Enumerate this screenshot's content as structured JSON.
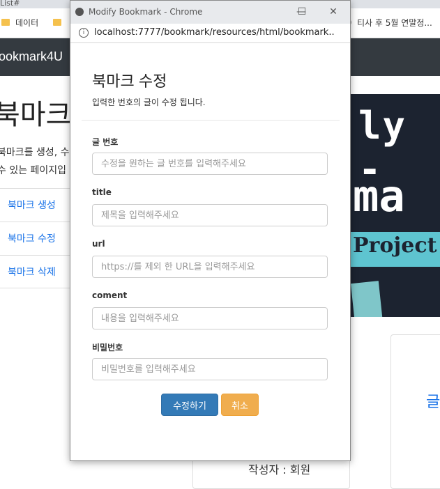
{
  "background": {
    "tab_fragment": "List#",
    "bookmarks_bar": [
      {
        "label": "데이터",
        "icon": "folder-icon"
      },
      {
        "label": "티사 후 5월 연말정...",
        "icon": "globe-icon"
      }
    ],
    "brand": "ookmark4U",
    "heading": "북마크",
    "description_line1": "북마크를 생성, 수",
    "description_line2": "수 있는 페이지입",
    "menu": [
      "북마크 생성",
      "북마크 수정",
      "북마크 삭제"
    ],
    "banner": {
      "line1": "ly -",
      "line2": "ma",
      "line3": "Project"
    },
    "card_title": "글",
    "author": "작성자 : 회원"
  },
  "popup": {
    "window_title": "Modify Bookmark - Chrome",
    "url": "localhost:7777/bookmark/resources/html/bookmark...",
    "form": {
      "title": "북마크 수정",
      "subtitle": "입력한 번호의 글이 수정 됩니다.",
      "fields": [
        {
          "label": "글 번호",
          "placeholder": "수정을 원하는 글 번호를 입력해주세요"
        },
        {
          "label": "title",
          "placeholder": "제목을 입력해주세요"
        },
        {
          "label": "url",
          "placeholder": "https://를 제외 한 URL을 입력해주세요"
        },
        {
          "label": "coment",
          "placeholder": "내용을 입력해주세요"
        },
        {
          "label": "비밀번호",
          "placeholder": "비밀번호를 입력해주세요"
        }
      ],
      "submit_label": "수정하기",
      "cancel_label": "취소"
    }
  },
  "colors": {
    "primary": "#337ab7",
    "warning": "#f0ad4e",
    "navbar": "#343a40",
    "link": "#1a73e8"
  }
}
